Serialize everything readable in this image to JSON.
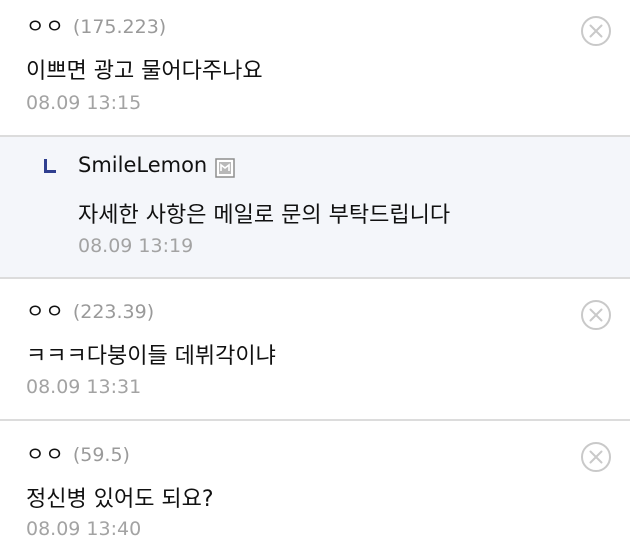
{
  "comments": [
    {
      "author": "ㅇㅇ",
      "ip": "(175.223)",
      "body": "이쁘면 광고 물어다주나요",
      "time": "08.09 13:15"
    },
    {
      "author": "SmileLemon",
      "body": "자세한 사항은 메일로 문의 부탁드립니다",
      "time": "08.09 13:19",
      "icon": "manager-badge-icon"
    },
    {
      "author": "ㅇㅇ",
      "ip": "(223.39)",
      "body": "ㅋㅋㅋ다붕이들 데뷔각이냐",
      "time": "08.09 13:31"
    },
    {
      "author": "ㅇㅇ",
      "ip": "(59.5)",
      "body": "정신병 있어도 되요?",
      "time": "08.09 13:40"
    }
  ],
  "icons": {
    "delete": "close-circle-icon",
    "reply": "reply-arrow-icon"
  },
  "colors": {
    "reply_bg": "#f4f6fa",
    "reply_mark": "#2f3f8f",
    "meta_gray": "#9a9a9a",
    "divider": "#dcdcdc"
  }
}
